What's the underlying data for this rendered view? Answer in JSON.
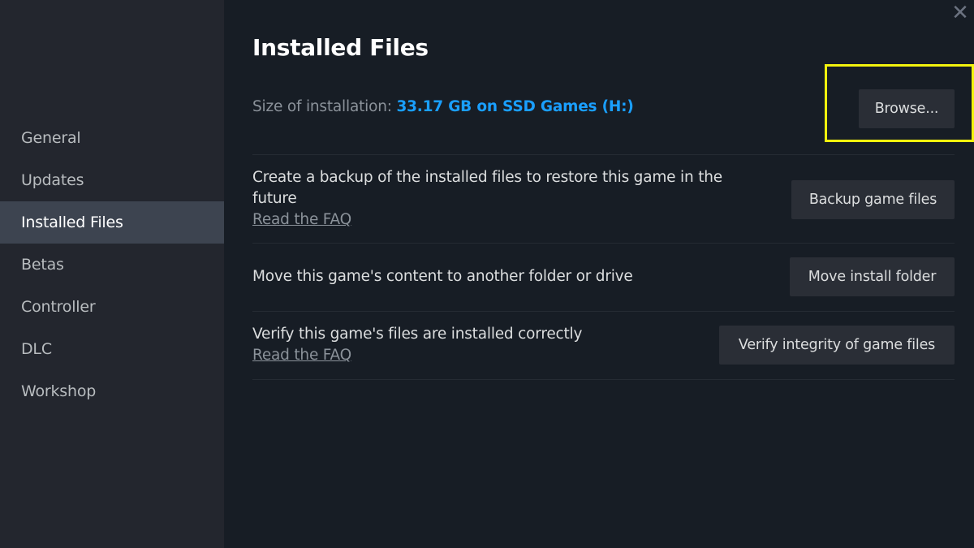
{
  "sidebar": {
    "items": [
      {
        "label": "General",
        "active": false
      },
      {
        "label": "Updates",
        "active": false
      },
      {
        "label": "Installed Files",
        "active": true
      },
      {
        "label": "Betas",
        "active": false
      },
      {
        "label": "Controller",
        "active": false
      },
      {
        "label": "DLC",
        "active": false
      },
      {
        "label": "Workshop",
        "active": false
      }
    ]
  },
  "window": {
    "close_icon": "close-x-icon",
    "close_glyph": "✕"
  },
  "main": {
    "title": "Installed Files",
    "size_label": "Size of installation:",
    "size_value": "33.17 GB on SSD Games (H:)",
    "browse_button": "Browse...",
    "sections": [
      {
        "description": "Create a backup of the installed files to restore this game in the future",
        "link": "Read the FAQ",
        "button": "Backup game files"
      },
      {
        "description": "Move this game's content to another folder or drive",
        "button": "Move install folder"
      },
      {
        "description": "Verify this game's files are installed correctly",
        "link": "Read the FAQ",
        "button": "Verify integrity of game files"
      }
    ]
  },
  "colors": {
    "accent": "#1a9fff",
    "highlight": "#f2f20d",
    "sidebar_bg": "#23262e",
    "main_bg": "#171d25",
    "active_item_bg": "#3d4450"
  }
}
